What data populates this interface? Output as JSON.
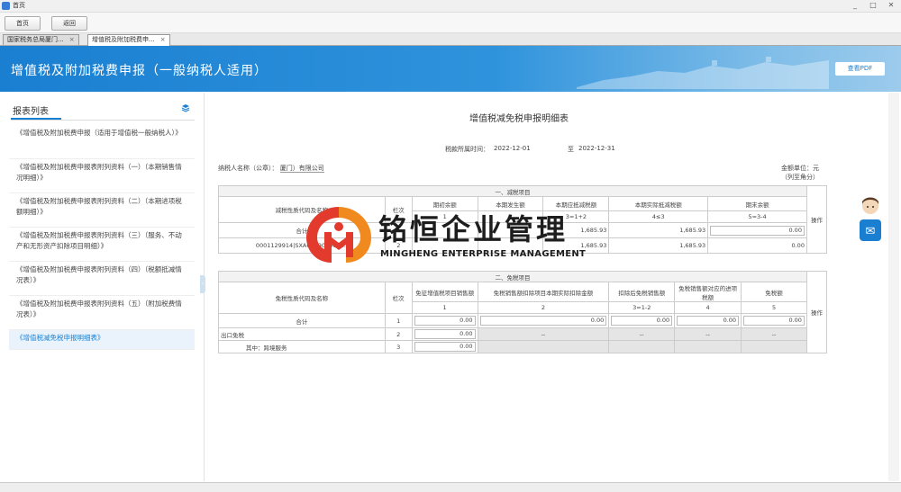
{
  "window": {
    "title": "首页",
    "min": "_",
    "max": "□",
    "close": "✕"
  },
  "toolbar": {
    "home_label": "首页",
    "back_label": "返回"
  },
  "tabs": [
    {
      "label": "国家税务总局厦门...",
      "close": "×"
    },
    {
      "label": "增值税及附加税费申...",
      "close": "×"
    }
  ],
  "banner": {
    "title": "增值税及附加税费申报（一般纳税人适用）",
    "pdf_button": "查看PDF"
  },
  "sidebar": {
    "heading": "报表列表",
    "items": [
      {
        "label": "《增值税及附加税费申报（适用于增值税一般纳税人）》"
      },
      {
        "label": "《增值税及附加税费申报表附列资料（一）（本期销售情况明细）》"
      },
      {
        "label": "《增值税及附加税费申报表附列资料（二）（本期进项税额明细）》"
      },
      {
        "label": "《增值税及附加税费申报表附列资料（三）（服务、不动产和无形资产扣除项目明细）》"
      },
      {
        "label": "《增值税及附加税费申报表附列资料（四）（税额抵减情况表）》"
      },
      {
        "label": "《增值税及附加税费申报表附列资料（五）（附加税费情况表）》"
      },
      {
        "label": "《增值税减免税申报明细表》"
      }
    ]
  },
  "form": {
    "title": "增值税减免税申报明细表",
    "period_from_label": "税款所属时间：",
    "period_from": "2022-12-01",
    "period_to_label": "至",
    "period_to": "2022-12-31",
    "taxpayer_label": "纳税人名称（公章）：",
    "taxpayer_value": "厦门）有限公司",
    "unit_label": "金额单位：元（列至角分）",
    "sec1_title": "一、减税项目",
    "sec1_headers": [
      "减税性质代码及名称",
      "栏次",
      "期初余额",
      "本期发生额",
      "本期应抵减税额",
      "本期实际抵减税额",
      "期末余额",
      "操作"
    ],
    "sec1_subheaders": [
      "",
      "",
      "1",
      "2",
      "3=1+2",
      "4≤3",
      "5=3-4",
      ""
    ],
    "sec1_rows": [
      {
        "name": "合计",
        "line": "1",
        "v1": "",
        "v2": "",
        "v3": "1,685.93",
        "v4": "1,685.93",
        "v5": "0.00"
      },
      {
        "name": "0001129914|SXA031901004|...",
        "line": "2",
        "v1": "",
        "v2": "",
        "v3": "1,685.93",
        "v4": "1,685.93",
        "v5": "0.00"
      }
    ],
    "sec2_title": "二、免税项目",
    "sec2_headers": [
      "免税性质代码及名称",
      "栏次",
      "免征增值税项目销售额",
      "免税销售额扣除项目本期实际扣除金额",
      "扣除后免税销售额",
      "免税销售额对应的进项税额",
      "免税额",
      "操作"
    ],
    "sec2_subheaders": [
      "1",
      "2",
      "3=1-2",
      "4",
      "5"
    ],
    "sec2_rows": [
      {
        "name": "合计",
        "line": "1",
        "v1": "0.00",
        "v2": "0.00",
        "v3": "0.00",
        "v4": "0.00",
        "v5": "0.00"
      },
      {
        "name": "出口免税",
        "line": "2",
        "v1": "0.00",
        "v2": "--",
        "v3": "--",
        "v4": "--",
        "v5": "--"
      },
      {
        "name": "其中：跨境服务",
        "line": "3",
        "v1": "0.00",
        "v2": "",
        "v3": "",
        "v4": "",
        "v5": ""
      }
    ],
    "op_label": "操作"
  },
  "watermark": {
    "cn": "铭恒企业管理",
    "en": "MINGHENG ENTERPRISE MANAGEMENT"
  },
  "colors": {
    "banner_blue": "#1a7fd1",
    "logo_red": "#e23b2e",
    "logo_orange": "#f08a1f"
  }
}
